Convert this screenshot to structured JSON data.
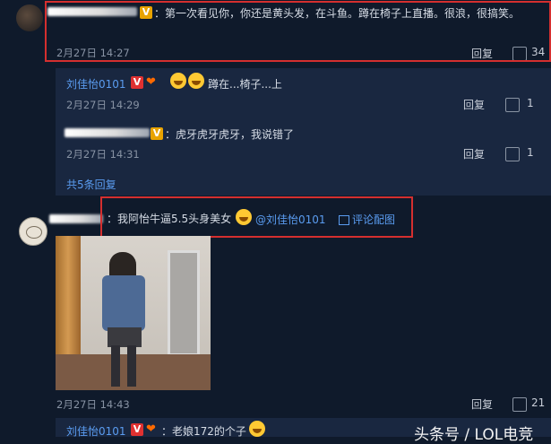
{
  "comment1": {
    "text": "：第一次看见你，你还是黄头发，在斗鱼。蹲在椅子上直播。很浪，很搞笑。",
    "time": "2月27日 14:27",
    "reply_label": "回复",
    "like_count": "34"
  },
  "replies": [
    {
      "username": "刘佳怡0101",
      "text": "蹲在...椅子...上",
      "time": "2月27日 14:29",
      "reply_label": "回复",
      "like_count": "1"
    },
    {
      "text": "：虎牙虎牙虎牙，我说错了",
      "time": "2月27日 14:31",
      "reply_label": "回复",
      "like_count": "1"
    }
  ],
  "more_replies": "共5条回复",
  "comment2": {
    "text": "：我阿怡牛逼5.5头身美女",
    "mention": "@刘佳怡0101",
    "view_image": "评论配图",
    "time": "2月27日 14:43",
    "reply_label": "回复",
    "like_count": "21"
  },
  "reply3": {
    "username": "刘佳怡0101",
    "text": "：老娘172的个子"
  },
  "watermark": "头条号 / LOL电竞",
  "colors": {
    "background": "#0f1a2b",
    "subpanel": "#192740",
    "link": "#5a9cf0",
    "highlight_box": "#d42f2f"
  }
}
